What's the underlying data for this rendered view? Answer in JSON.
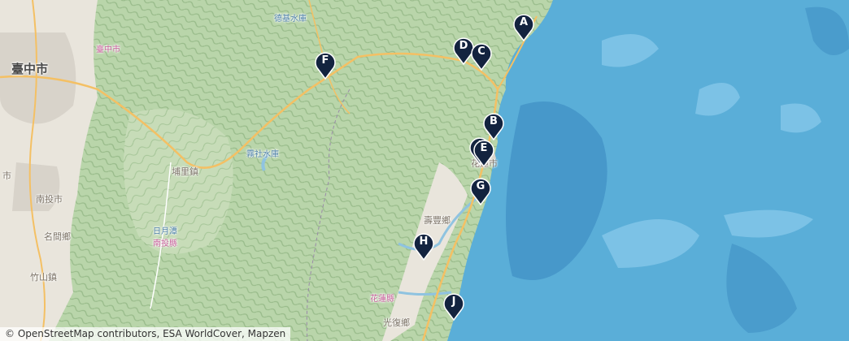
{
  "map": {
    "colors": {
      "sea": "#5aaed8",
      "deep_sea": "#3f8fc4",
      "shallow_sea": "#7cc2e6",
      "mountain_green": "#b7d3a9",
      "lowland": "#e9e5dc",
      "urban": "#d8d3ca",
      "river": "#8fc3e0",
      "road_major": "#f4c064",
      "road_minor": "#ffffff",
      "marker": "#13233f"
    },
    "places": [
      {
        "id": "taichung",
        "label": "臺中市",
        "style": "big"
      },
      {
        "id": "taichung-small",
        "label": "臺中市",
        "style": "pink"
      },
      {
        "id": "deji",
        "label": "德基水庫",
        "style": "water"
      },
      {
        "id": "wushe",
        "label": "霧社水庫",
        "style": "water"
      },
      {
        "id": "puli",
        "label": "埔里鎮",
        "style": "normal"
      },
      {
        "id": "nantou-city",
        "label": "南投市",
        "style": "normal"
      },
      {
        "id": "nantou-cut",
        "label": "市",
        "style": "normal"
      },
      {
        "id": "sunmoon",
        "label": "日月潭",
        "style": "water"
      },
      {
        "id": "nantou-county",
        "label": "南投縣",
        "style": "pink"
      },
      {
        "id": "mingjian",
        "label": "名間鄉",
        "style": "normal"
      },
      {
        "id": "zhushan",
        "label": "竹山鎮",
        "style": "normal"
      },
      {
        "id": "hualien-city",
        "label": "花蓮市",
        "style": "normal"
      },
      {
        "id": "shoufeng",
        "label": "壽豐鄉",
        "style": "normal"
      },
      {
        "id": "hualien-county",
        "label": "花蓮縣",
        "style": "pink"
      },
      {
        "id": "guangfu",
        "label": "光復鄉",
        "style": "normal"
      }
    ],
    "markers": [
      {
        "label": "A"
      },
      {
        "label": "D"
      },
      {
        "label": "C"
      },
      {
        "label": "F"
      },
      {
        "label": "B"
      },
      {
        "label": "I"
      },
      {
        "label": "E"
      },
      {
        "label": "G"
      },
      {
        "label": "H"
      },
      {
        "label": "J"
      }
    ],
    "attribution": "© OpenStreetMap contributors, ESA WorldCover, Mapzen"
  }
}
